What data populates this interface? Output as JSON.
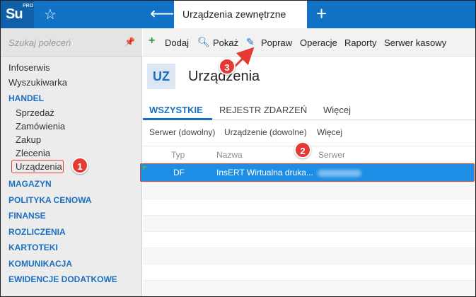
{
  "app": {
    "logo_text": "Su",
    "logo_sup": "PRO"
  },
  "header": {
    "active_tab": "Urządzenia zewnętrzne"
  },
  "sidebar": {
    "search_placeholder": "Szukaj poleceń",
    "items": [
      {
        "label": "Infoserwis"
      },
      {
        "label": "Wyszukiwarka"
      }
    ],
    "handel_section": "HANDEL",
    "handel_items": [
      {
        "label": "Sprzedaż"
      },
      {
        "label": "Zamówienia"
      },
      {
        "label": "Zakup"
      },
      {
        "label": "Zlecenia"
      },
      {
        "label": "Urządzenia"
      }
    ],
    "sections": [
      {
        "label": "MAGAZYN"
      },
      {
        "label": "POLITYKA CENOWA"
      },
      {
        "label": "FINANSE"
      },
      {
        "label": "ROZLICZENIA"
      },
      {
        "label": "KARTOTEKI"
      },
      {
        "label": "KOMUNIKACJA"
      },
      {
        "label": "EWIDENCJE DODATKOWE"
      }
    ]
  },
  "toolbar": {
    "add": "Dodaj",
    "show": "Pokaż",
    "edit": "Popraw",
    "operations": "Operacje",
    "reports": "Raporty",
    "server": "Serwer kasowy"
  },
  "page": {
    "badge": "UZ",
    "title": "Urządzenia"
  },
  "tabs": {
    "all": "WSZYSTKIE",
    "events": "REJESTR ZDARZEŃ",
    "more": "Więcej"
  },
  "filters": {
    "server": "Serwer (dowolny)",
    "device": "Urządzenie (dowolne)",
    "more": "Więcej"
  },
  "grid": {
    "columns": {
      "type": "Typ",
      "name": "Nazwa",
      "server": "Serwer"
    },
    "selected_row": {
      "type": "DF",
      "name": "InsERT Wirtualna druka..."
    }
  },
  "callouts": {
    "c1": "1",
    "c2": "2",
    "c3": "3"
  },
  "colors": {
    "brand": "#1273c6",
    "accent": "#1a6fc0",
    "selection": "#1d8ee6",
    "annotation": "#e53935"
  }
}
